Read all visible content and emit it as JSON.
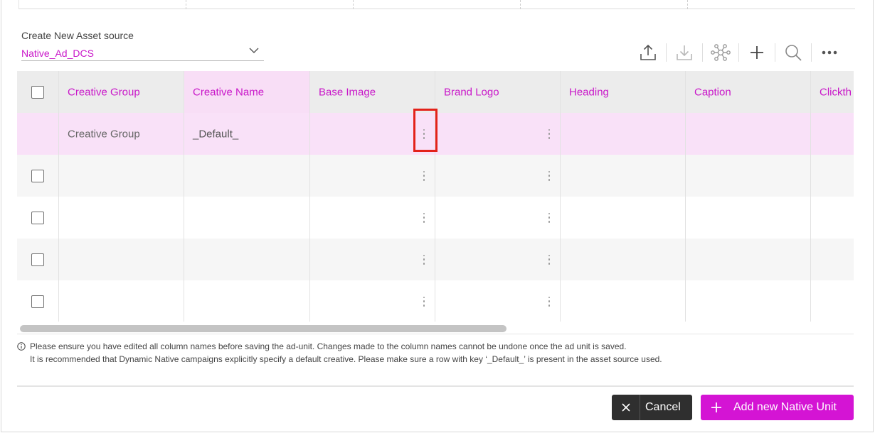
{
  "source": {
    "label": "Create New Asset source",
    "selected": "Native_Ad_DCS"
  },
  "toolbar": {
    "icons": [
      "upload-icon",
      "download-icon",
      "network-icon",
      "plus-icon",
      "search-icon",
      "more-icon"
    ]
  },
  "grid": {
    "columns": [
      "Creative Group",
      "Creative Name",
      "Base Image",
      "Brand Logo",
      "Heading",
      "Caption",
      "Clickth"
    ],
    "rows": [
      {
        "creative_group": "Creative Group",
        "creative_name": "_Default_"
      },
      {
        "creative_group": "",
        "creative_name": ""
      },
      {
        "creative_group": "",
        "creative_name": ""
      },
      {
        "creative_group": "",
        "creative_name": ""
      },
      {
        "creative_group": "",
        "creative_name": ""
      }
    ]
  },
  "notes": {
    "line1": "Please ensure you have edited all column names before saving the ad-unit. Changes made to the column names cannot be undone once the ad unit is saved.",
    "line2": "It is recommended that Dynamic Native campaigns explicitly specify a default creative. Please make sure a row with key ‘_Default_’ is present in the asset source used."
  },
  "buttons": {
    "cancel": "Cancel",
    "add": "Add new Native Unit"
  },
  "colors": {
    "accent": "#c917c9",
    "header_bg": "#ececec",
    "highlight_col": "#f8def6",
    "selected_row": "#f9e1f8",
    "alt_row": "#f6f6f6",
    "cancel_bg": "#2f2f2f",
    "add_bg": "#d414d4",
    "marker": "#e3221a"
  }
}
